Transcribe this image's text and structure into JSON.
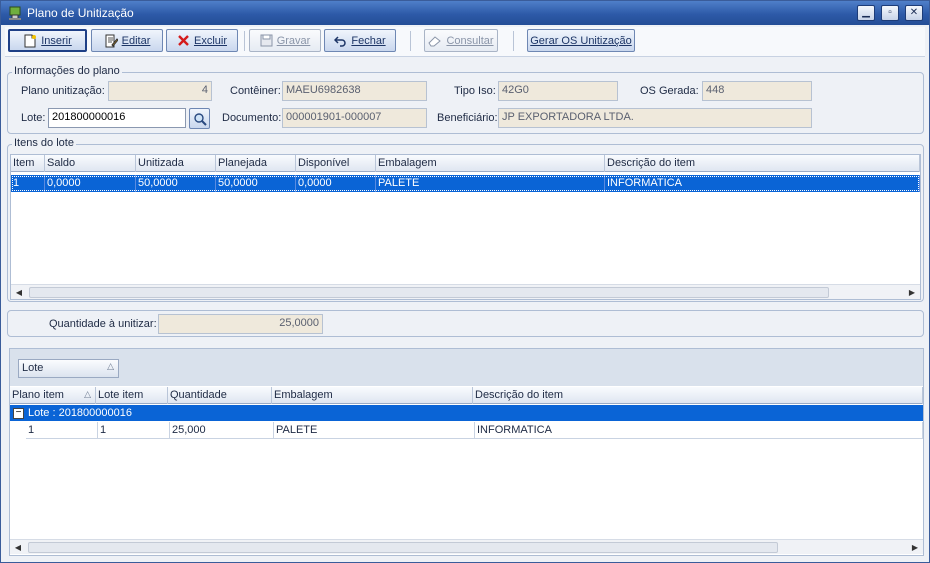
{
  "window": {
    "title": "Plano de Unitização",
    "minimize_icon": "minimize-icon",
    "maximize_icon": "maximize-icon",
    "close_icon": "close-icon"
  },
  "toolbar": {
    "inserir": "Inserir",
    "editar": "Editar",
    "excluir": "Excluir",
    "gravar": "Gravar",
    "fechar": "Fechar",
    "consultar": "Consultar",
    "gerar_os": "Gerar OS Unitização"
  },
  "plan_info": {
    "legend": "Informações do plano",
    "plano_label": "Plano unitização:",
    "plano_value": "4",
    "conteiner_label": "Contêiner:",
    "conteiner_value": "MAEU6982638",
    "tipo_iso_label": "Tipo Iso:",
    "tipo_iso_value": "42G0",
    "os_gerada_label": "OS Gerada:",
    "os_gerada_value": "448",
    "lote_label": "Lote:",
    "lote_value": "201800000016",
    "documento_label": "Documento:",
    "documento_value": "000001901-000007",
    "beneficiario_label": "Beneficiário:",
    "beneficiario_value": "JP EXPORTADORA LTDA."
  },
  "itens_lote": {
    "legend": "Itens do lote",
    "columns": [
      "Item",
      "Saldo",
      "Unitizada",
      "Planejada",
      "Disponível",
      "Embalagem",
      "Descrição do item"
    ],
    "rows": [
      [
        "1",
        "0,0000",
        "50,0000",
        "50,0000",
        "0,0000",
        "PALETE",
        "INFORMATICA"
      ]
    ]
  },
  "quantidade": {
    "label": "Quantidade à unitizar:",
    "value": "25,0000"
  },
  "bottom_grid": {
    "group_button": "Lote",
    "columns": [
      "Plano item",
      "Lote item",
      "Quantidade",
      "Embalagem",
      "Descrição do item"
    ],
    "group_label": "Lote : 201800000016",
    "rows": [
      [
        "1",
        "1",
        "25,000",
        "PALETE",
        "INFORMATICA"
      ]
    ]
  },
  "colors": {
    "titlebar": "#2d5aa8",
    "selection": "#0a64d6",
    "readonly_field": "#efe9dc"
  }
}
